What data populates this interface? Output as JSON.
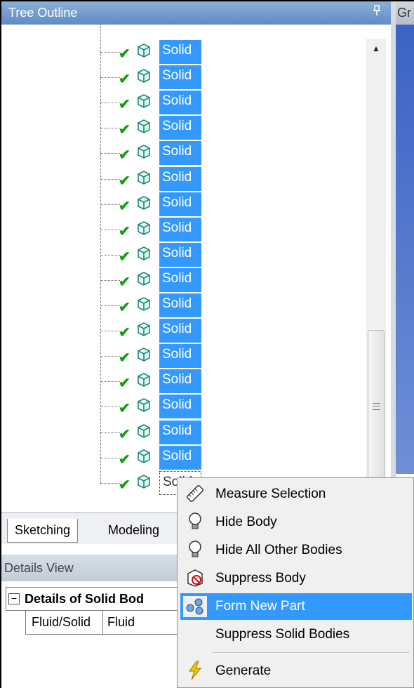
{
  "tree_outline": {
    "title": "Tree Outline",
    "pin_glyph": "!",
    "items": [
      {
        "label": "Solid"
      },
      {
        "label": "Solid"
      },
      {
        "label": "Solid"
      },
      {
        "label": "Solid"
      },
      {
        "label": "Solid"
      },
      {
        "label": "Solid"
      },
      {
        "label": "Solid"
      },
      {
        "label": "Solid"
      },
      {
        "label": "Solid"
      },
      {
        "label": "Solid"
      },
      {
        "label": "Solid"
      },
      {
        "label": "Solid"
      },
      {
        "label": "Solid"
      },
      {
        "label": "Solid"
      },
      {
        "label": "Solid"
      },
      {
        "label": "Solid"
      },
      {
        "label": "Solid"
      },
      {
        "label": "Solid"
      }
    ],
    "check_icon": "checkmark-icon",
    "body_icon": "solid-body-icon",
    "selection_color": "#3399ff"
  },
  "graphics_panel": {
    "title_fragment": "Gr"
  },
  "tabs": [
    {
      "label": "Sketching"
    },
    {
      "label": "Modeling"
    }
  ],
  "details_view": {
    "title": "Details View",
    "group_toggle": "−",
    "group_title": "Details of Solid Bod",
    "rows": [
      {
        "key": "Fluid/Solid",
        "value": "Fluid"
      }
    ]
  },
  "context_menu": {
    "items": [
      {
        "label": "Measure Selection",
        "icon": "ruler-icon"
      },
      {
        "label": "Hide Body",
        "icon": "lightbulb-icon"
      },
      {
        "label": "Hide All Other Bodies",
        "icon": "lightbulb-icon"
      },
      {
        "label": "Suppress Body",
        "icon": "suppress-body-icon"
      },
      {
        "label": "Form New Part",
        "icon": "form-part-icon"
      },
      {
        "label": "Suppress Solid Bodies",
        "icon": ""
      },
      {
        "label": "Generate",
        "icon": "lightning-icon"
      }
    ],
    "highlight_color": "#3399ff"
  }
}
